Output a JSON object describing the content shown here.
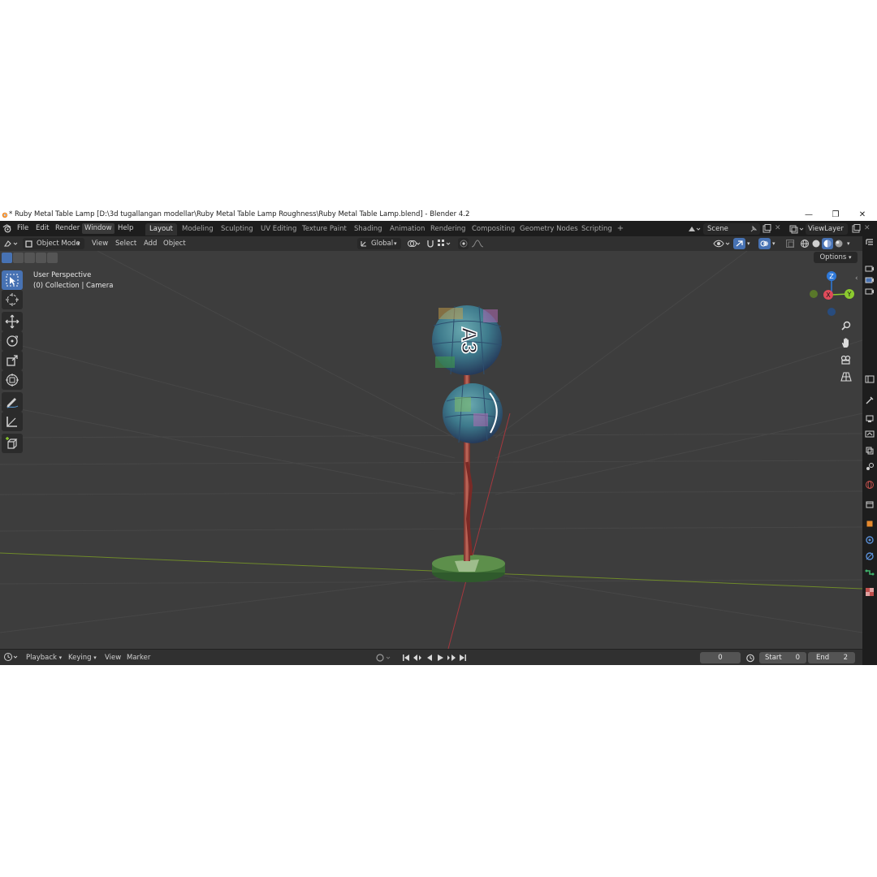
{
  "window": {
    "title": "* Ruby Metal Table Lamp [D:\\3d tugallangan modellar\\Ruby Metal Table Lamp Roughness\\Ruby Metal Table Lamp.blend] - Blender 4.2",
    "minimize": "—",
    "restore": "❐",
    "close": "✕"
  },
  "menu": {
    "items": [
      "File",
      "Edit",
      "Render",
      "Window",
      "Help"
    ]
  },
  "workspaces": {
    "tabs": [
      "Layout",
      "Modeling",
      "Sculpting",
      "UV Editing",
      "Texture Paint",
      "Shading",
      "Animation",
      "Rendering",
      "Compositing",
      "Geometry Nodes",
      "Scripting"
    ],
    "active": "Layout",
    "add": "+"
  },
  "scene": {
    "name": "Scene"
  },
  "view_layer": {
    "name": "ViewLayer"
  },
  "viewport_header": {
    "mode": "Object Mode",
    "menus": [
      "View",
      "Select",
      "Add",
      "Object"
    ],
    "orientation": "Global"
  },
  "viewport": {
    "perspective": "User Perspective",
    "collection": "(0) Collection | Camera",
    "options": "Options",
    "gizmo": {
      "z": "Z",
      "y": "Y",
      "x": "X"
    },
    "sphere_label": "A3"
  },
  "timeline": {
    "menus": [
      "Playback",
      "Keying",
      "View",
      "Marker"
    ],
    "current_frame": "0",
    "start_label": "Start",
    "start": "0",
    "end_label": "End",
    "end": "2"
  },
  "colors": {
    "accent": "#4772b3",
    "viewport_bg": "#3d3d3d",
    "axis_x": "#e04b5a",
    "axis_y": "#8ccb2f",
    "axis_z": "#2f79d9"
  }
}
